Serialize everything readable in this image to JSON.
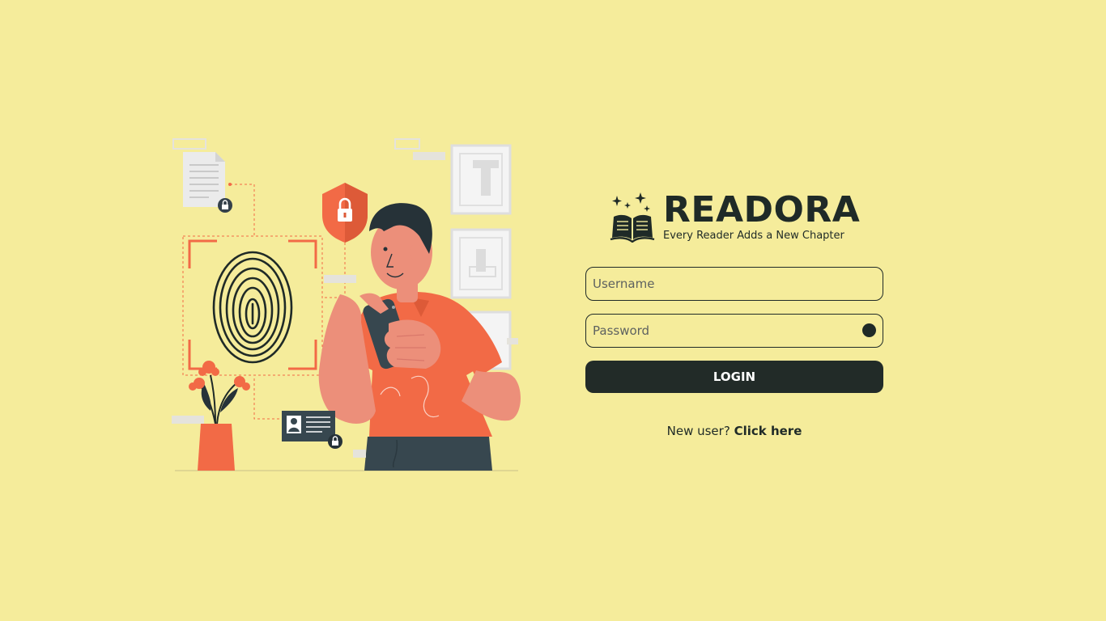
{
  "brand": {
    "name": "READORA",
    "tagline": "Every Reader Adds a New Chapter"
  },
  "form": {
    "username_placeholder": "Username",
    "username_value": "",
    "password_placeholder": "Password",
    "password_value": "",
    "login_label": "LOGIN"
  },
  "signup": {
    "prompt": "New user?",
    "link_label": "Click here"
  },
  "icons": {
    "logo": "open-book-sparkles-icon",
    "password_toggle": "eye-toggle-icon"
  },
  "colors": {
    "background": "#f5ec9b",
    "primary_dark": "#222b28",
    "accent_orange": "#f26a46",
    "skin": "#ec8f7a"
  }
}
